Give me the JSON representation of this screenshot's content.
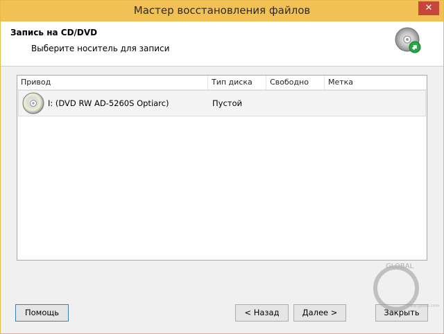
{
  "window": {
    "title": "Мастер восстановления файлов",
    "close_glyph": "✕",
    "accent": "#f2c155"
  },
  "header": {
    "title": "Запись на CD/DVD",
    "subtitle": "Выберите носитель для записи",
    "icon": "cd-burn-icon"
  },
  "table": {
    "columns": [
      "Привод",
      "Тип диска",
      "Свободно",
      "Метка"
    ],
    "rows": [
      {
        "drive": "I: (DVD RW AD-5260S Optiarc)",
        "type": "Пустой",
        "free": "",
        "label": "",
        "icon": "cd-disc-icon"
      }
    ]
  },
  "buttons": {
    "help": "Помощь",
    "back": "< Назад",
    "next": "Далее >",
    "close": "Закрыть"
  },
  "watermark": {
    "text": "GLOBAL",
    "site": "www.geoid.com"
  }
}
